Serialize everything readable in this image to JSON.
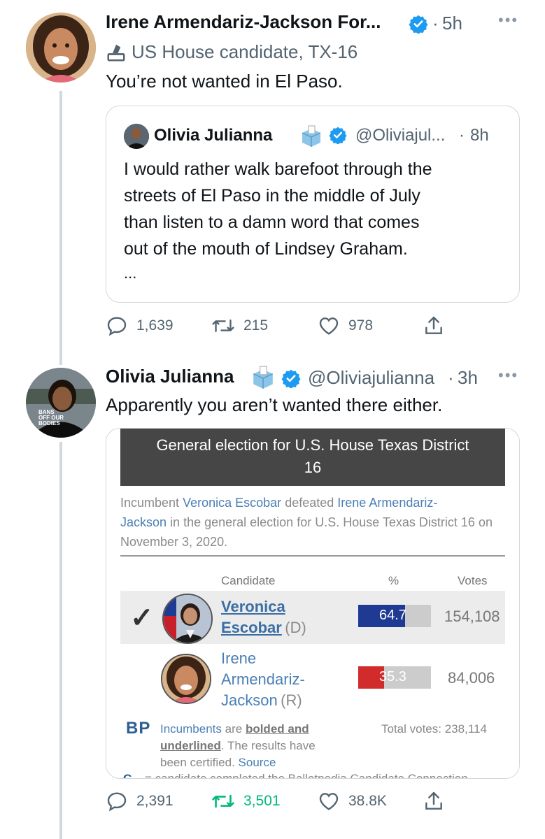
{
  "tweet1": {
    "author": "Irene Armendariz-Jackson For...",
    "time": "5h",
    "label": "US House candidate, TX-16",
    "text": "You’re not wanted in El Paso.",
    "quote": {
      "author": "Olivia Julianna",
      "handle": "@Oliviajul...",
      "time": "8h",
      "lines": [
        "I would rather walk barefoot through the",
        "streets of El Paso in the middle of July",
        "than listen to a damn word that comes",
        "out of the mouth of Lindsey Graham."
      ],
      "ellipsis": "..."
    },
    "actions": {
      "replies": "1,639",
      "retweets": "215",
      "likes": "978"
    }
  },
  "tweet2": {
    "author": "Olivia Julianna",
    "handle": "@Oliviajulianna",
    "time": "3h",
    "text": "Apparently you aren’t wanted there either.",
    "avatar_text": [
      "BANS",
      "OFF OUR",
      "BODIES"
    ],
    "embed": {
      "title_line1": "General election for U.S. House Texas District",
      "title_line2": "16",
      "summary": {
        "incumbent_word": "Incumbent",
        "winner": "Veronica Escobar",
        "defeated": "defeated",
        "loser_a": "Irene Armendariz-",
        "loser_b": "Jackson",
        "rest": "in the general election for U.S. House Texas District 16 on November 3, 2020."
      },
      "columns": {
        "candidate": "Candidate",
        "pct": "%",
        "votes": "Votes"
      },
      "rows": [
        {
          "name_line1": "Veronica",
          "name_line2": "Escobar",
          "party": "(D)",
          "pct": 64.7,
          "pct_label": "64.7",
          "votes": "154,108",
          "winner_mark": "✓"
        },
        {
          "name_line1": "Irene",
          "name_line2": "Armendariz-",
          "name_line3": "Jackson",
          "party": "(R)",
          "pct": 35.3,
          "pct_label": "35.3",
          "votes": "84,006"
        }
      ],
      "bp_logo": "BP",
      "footer_incumbents": "Incumbents",
      "footer_are": "are",
      "footer_bolded": "bolded and",
      "footer_underlined": "underlined",
      "footer_rest1": ". The results have",
      "footer_rest2": "been certified.",
      "footer_source": "Source",
      "footer_cut": "= candidate completed the Ballotpedia Candidate Connection",
      "total_votes": "Total votes: 238,114"
    },
    "actions": {
      "replies": "2,391",
      "retweets": "3,501",
      "likes": "38.8K"
    }
  },
  "colors": {
    "verified": "#1d9bf0",
    "retweet_active": "#00ba7c",
    "dem": "#1f3a93",
    "rep": "#d22b2b"
  }
}
